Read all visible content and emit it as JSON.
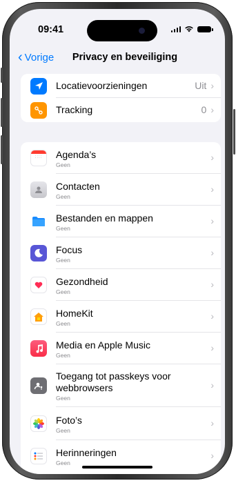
{
  "status_bar": {
    "time": "09:41"
  },
  "nav": {
    "back_label": "Vorige",
    "title": "Privacy en beveiliging"
  },
  "top_group": [
    {
      "label": "Locatievoorzieningen",
      "value": "Uit",
      "icon": "location-arrow-icon",
      "color": "#007aff"
    },
    {
      "label": "Tracking",
      "value": "0",
      "icon": "tracking-icon",
      "color": "#ff9500"
    }
  ],
  "apps": [
    {
      "label": "Agenda’s",
      "sub": "Geen",
      "icon": "calendar-icon"
    },
    {
      "label": "Contacten",
      "sub": "Geen",
      "icon": "contacts-icon"
    },
    {
      "label": "Bestanden en mappen",
      "sub": "Geen",
      "icon": "folder-icon"
    },
    {
      "label": "Focus",
      "sub": "Geen",
      "icon": "moon-icon"
    },
    {
      "label": "Gezondheid",
      "sub": "Geen",
      "icon": "heart-icon"
    },
    {
      "label": "HomeKit",
      "sub": "Geen",
      "icon": "home-icon"
    },
    {
      "label": "Media en Apple Music",
      "sub": "Geen",
      "icon": "music-note-icon"
    },
    {
      "label": "Toegang tot passkeys voor webbrowsers",
      "sub": "Geen",
      "icon": "passkey-person-icon"
    },
    {
      "label": "Foto’s",
      "sub": "Geen",
      "icon": "photos-flower-icon"
    },
    {
      "label": "Herinneringen",
      "sub": "Geen",
      "icon": "reminders-list-icon"
    }
  ],
  "colors": {
    "accent": "#007aff",
    "background": "#f2f2f7",
    "secondary_text": "#8a8a8e"
  }
}
